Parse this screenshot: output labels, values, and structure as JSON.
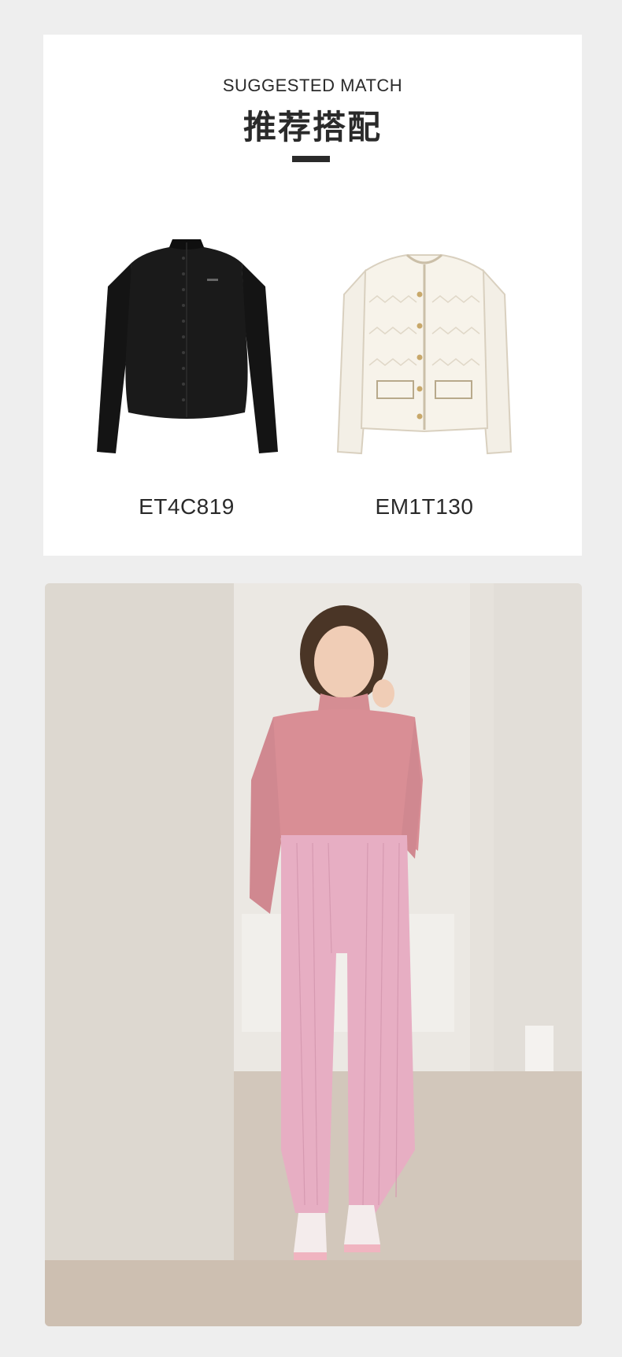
{
  "match": {
    "title_en": "SUGGESTED MATCH",
    "title_cn": "推荐搭配",
    "products": [
      {
        "code": "ET4C819",
        "icon": "black-top-icon"
      },
      {
        "code": "EM1T130",
        "icon": "cream-jacket-icon"
      }
    ]
  },
  "colors": {
    "page_bg": "#eeeeee",
    "card_bg": "#ffffff",
    "text": "#2a2a2a",
    "pink_top": "#d98e95",
    "pink_pants": "#e7aec3"
  }
}
